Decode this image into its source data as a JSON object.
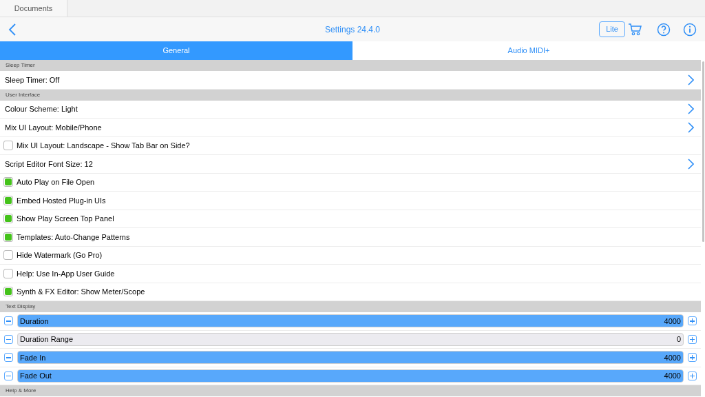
{
  "top_tabs": [
    {
      "label": "Documents",
      "selected": true
    }
  ],
  "header": {
    "title": "Settings 24.4.0",
    "badge": "Lite"
  },
  "tabs": [
    {
      "label": "General",
      "selected": true
    },
    {
      "label": "Audio MIDI+",
      "selected": false
    }
  ],
  "sections": [
    {
      "title": "Sleep Timer",
      "rows": [
        {
          "kind": "disclosure",
          "label": "Sleep Timer: Off"
        }
      ]
    },
    {
      "title": "User Interface",
      "rows": [
        {
          "kind": "disclosure",
          "label": "Colour Scheme: Light"
        },
        {
          "kind": "disclosure",
          "label": "Mix UI Layout: Mobile/Phone"
        },
        {
          "kind": "checkbox",
          "label": "Mix UI Layout: Landscape - Show Tab Bar on Side?",
          "checked": false
        },
        {
          "kind": "disclosure",
          "label": "Script Editor Font Size: 12"
        },
        {
          "kind": "checkbox",
          "label": "Auto Play on File Open",
          "checked": true
        },
        {
          "kind": "checkbox",
          "label": "Embed Hosted Plug-in UIs",
          "checked": true
        },
        {
          "kind": "checkbox",
          "label": "Show Play Screen Top Panel",
          "checked": true
        },
        {
          "kind": "checkbox",
          "label": "Templates: Auto-Change Patterns",
          "checked": true
        },
        {
          "kind": "checkbox",
          "label": "Hide Watermark (Go Pro)",
          "checked": false
        },
        {
          "kind": "checkbox",
          "label": "Help: Use In-App User Guide",
          "checked": false
        },
        {
          "kind": "checkbox",
          "label": "Synth & FX Editor: Show Meter/Scope",
          "checked": true
        }
      ]
    },
    {
      "title": "Text Display",
      "rows": [
        {
          "kind": "slider",
          "label": "Duration",
          "reading": "4000",
          "level": 1
        },
        {
          "kind": "slider",
          "label": "Duration Range",
          "reading": "0",
          "level": 0
        },
        {
          "kind": "slider",
          "label": "Fade In",
          "reading": "4000",
          "level": 1
        },
        {
          "kind": "slider",
          "label": "Fade Out",
          "reading": "4000",
          "level": 1
        }
      ]
    },
    {
      "title": "Help & More"
    }
  ]
}
